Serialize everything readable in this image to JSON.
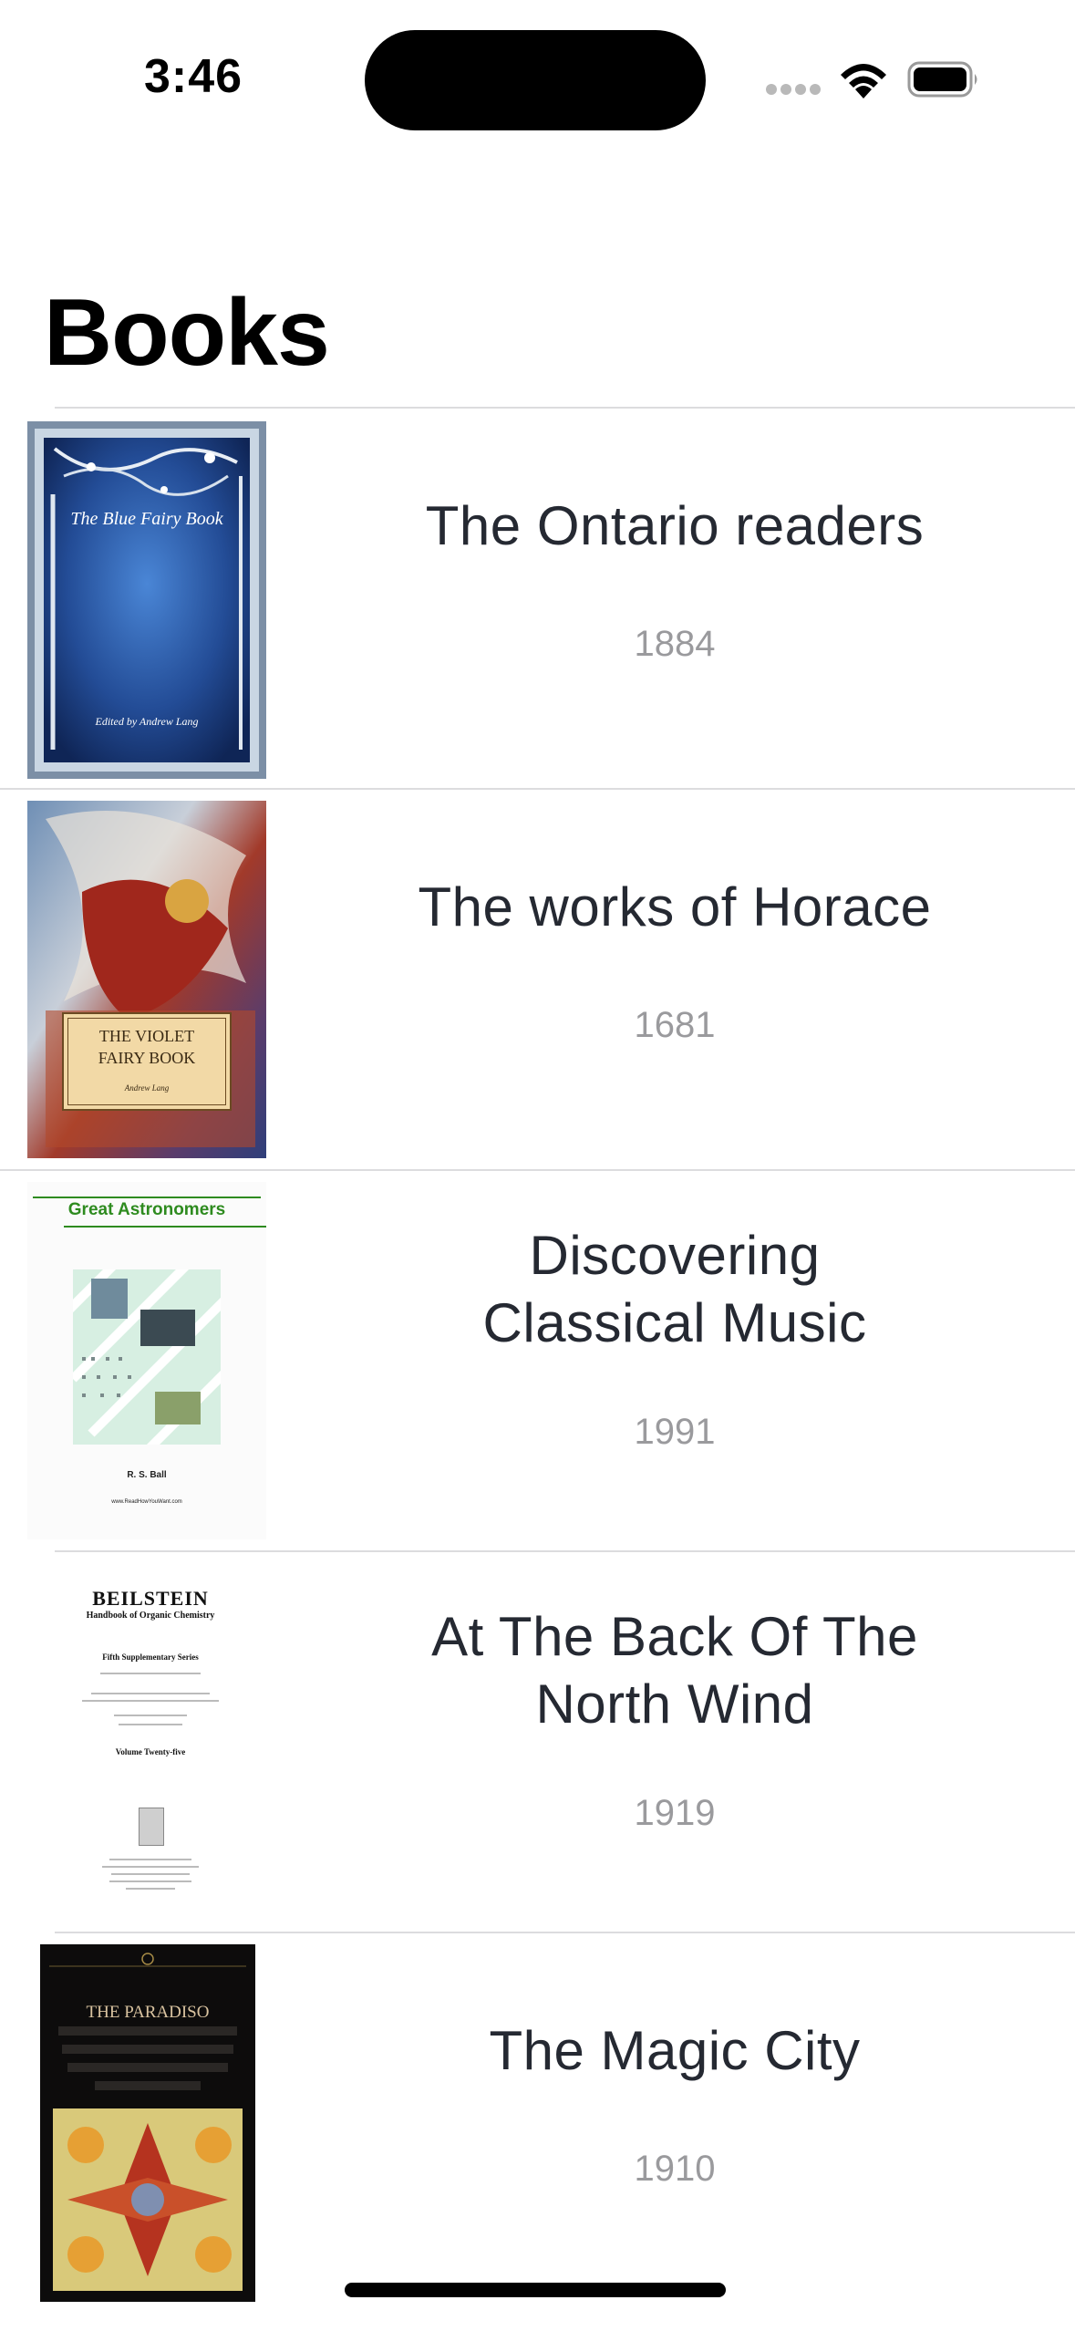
{
  "status_bar": {
    "time": "3:46",
    "icons": [
      "cellular-signal-icon",
      "wifi-icon",
      "battery-icon"
    ]
  },
  "header": {
    "title": "Books"
  },
  "books": [
    {
      "title": "The Ontario readers",
      "year": "1884",
      "cover_text": [
        "The Blue Fairy Book",
        "Edited by Andrew Lang"
      ]
    },
    {
      "title": "The works of Horace",
      "year": "1681",
      "cover_text": [
        "THE VIOLET",
        "FAIRY BOOK",
        "Andrew Lang"
      ]
    },
    {
      "title": "Discovering Classical Music",
      "year": "1991",
      "cover_text": [
        "Great Astronomers",
        "R. S. Ball",
        "www.ReadHowYouWant.com"
      ]
    },
    {
      "title": "At The Back Of The North Wind",
      "year": "1919",
      "cover_text": [
        "BEILSTEIN",
        "Handbook of Organic Chemistry",
        "Fifth Supplementary Series",
        "Volume Twenty-five"
      ]
    },
    {
      "title": "The Magic City",
      "year": "1910",
      "cover_text": [
        "THE PARADISO"
      ]
    }
  ],
  "colors": {
    "title_text": "#252932",
    "year_text": "#9a9a9d",
    "separator": "#dcdcde",
    "accent_green": "#2e8b1f"
  }
}
